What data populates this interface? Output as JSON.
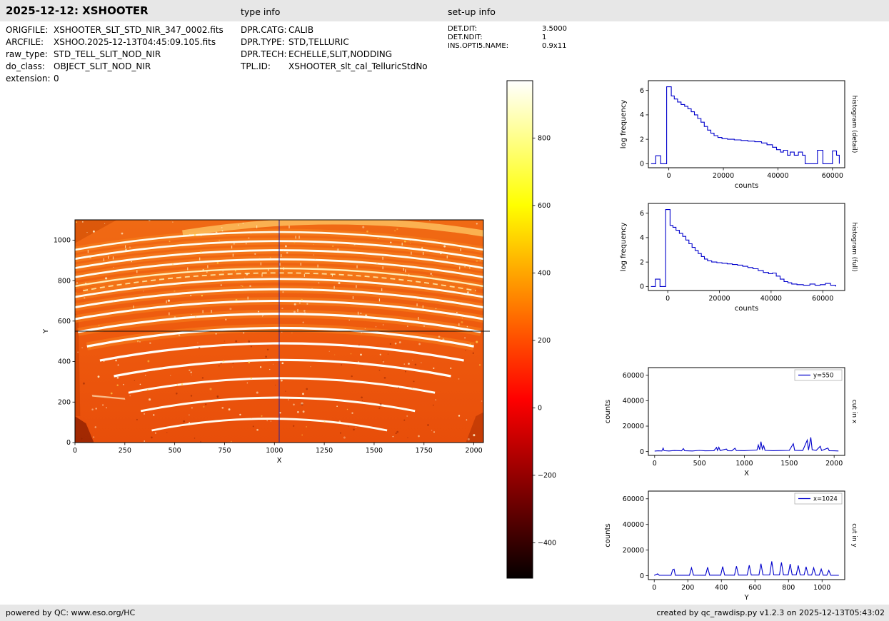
{
  "header": {
    "title": "2025-12-12: XSHOOTER",
    "type_info_title": "type info",
    "setup_info_title": "set-up info"
  },
  "file_info": {
    "rows": [
      {
        "label": "ORIGFILE:",
        "value": "XSHOOTER_SLT_STD_NIR_347_0002.fits"
      },
      {
        "label": "ARCFILE:",
        "value": "XSHOO.2025-12-13T04:45:09.105.fits"
      },
      {
        "label": "raw_type:",
        "value": "STD_TELL_SLIT_NOD_NIR"
      },
      {
        "label": "do_class:",
        "value": "OBJECT_SLIT_NOD_NIR"
      },
      {
        "label": "extension:",
        "value": "0"
      }
    ]
  },
  "type_info": {
    "rows": [
      {
        "label": "DPR.CATG:",
        "value": "CALIB"
      },
      {
        "label": "DPR.TYPE:",
        "value": "STD,TELLURIC"
      },
      {
        "label": "DPR.TECH:",
        "value": "ECHELLE,SLIT,NODDING"
      },
      {
        "label": "TPL.ID:",
        "value": "XSHOOTER_slt_cal_TelluricStdNo"
      }
    ]
  },
  "setup_info": {
    "rows": [
      {
        "label": "DET.DIT:",
        "value": "3.5000"
      },
      {
        "label": "DET.NDIT:",
        "value": "1"
      },
      {
        "label": "INS.OPTI5.NAME:",
        "value": "0.9x11"
      }
    ]
  },
  "footer": {
    "left": "powered by QC: www.eso.org/HC",
    "right": "created by qc_rawdisp.py v1.2.3 on 2025-12-13T05:43:02"
  },
  "chart_data": [
    {
      "id": "raw-image",
      "type": "heatmap",
      "description": "XSHOOTER NIR raw detector frame: bright curved echelle orders on orange background (hot colormap), crosshair cuts at x=1024 and y=550",
      "xlabel": "X",
      "ylabel": "Y",
      "xlim": [
        0,
        2048
      ],
      "ylim": [
        0,
        1100
      ],
      "xticks": [
        0,
        250,
        500,
        750,
        1000,
        1250,
        1500,
        1750,
        2000
      ],
      "yticks": [
        0,
        200,
        400,
        600,
        800,
        1000
      ],
      "colormap": "hot",
      "background_color": "#ee5a0e",
      "crosshair": {
        "x": 1024,
        "y": 550,
        "x_color": "#2020a0",
        "y_color": "#101010"
      },
      "noise_seed": 20251212,
      "noise_dots": 260,
      "dark_dots": 60,
      "skyline_count": 55,
      "orders": [
        {
          "yc": 1093,
          "sag": 60,
          "x0": 540,
          "x1": 2048,
          "w": 9,
          "color": "#ffc966",
          "opacity": 0.75
        },
        {
          "yc": 1040,
          "sag": 88,
          "x0": 0,
          "x1": 2048,
          "w": 2.6,
          "color": "#fffbea"
        },
        {
          "yc": 995,
          "sag": 88,
          "x0": 0,
          "x1": 2048,
          "w": 2.8,
          "color": "#fffdf2"
        },
        {
          "yc": 950,
          "sag": 88,
          "x0": 0,
          "x1": 2048,
          "w": 2.8,
          "color": "#fffdf2"
        },
        {
          "yc": 905,
          "sag": 88,
          "x0": 0,
          "x1": 2048,
          "w": 2.8,
          "color": "#fffcf0"
        },
        {
          "yc": 860,
          "sag": 88,
          "x0": 0,
          "x1": 2048,
          "w": 2.4,
          "color": "#ffedb8"
        },
        {
          "yc": 838,
          "sag": 88,
          "x0": 40,
          "x1": 2010,
          "w": 1.8,
          "color": "#ffe9a8",
          "dash": true,
          "opacity": 0.9
        },
        {
          "yc": 808,
          "sag": 89,
          "x0": 0,
          "x1": 2048,
          "w": 2.8,
          "color": "#fffcf0"
        },
        {
          "yc": 757,
          "sag": 89,
          "x0": 0,
          "x1": 2048,
          "w": 3,
          "color": "#fffdf4"
        },
        {
          "yc": 700,
          "sag": 90,
          "x0": 0,
          "x1": 2048,
          "w": 3,
          "color": "#fffef8"
        },
        {
          "yc": 636,
          "sag": 90,
          "x0": 15,
          "x1": 2035,
          "w": 3.2,
          "color": "#fffef8"
        },
        {
          "yc": 566,
          "sag": 91,
          "x0": 60,
          "x1": 2000,
          "w": 3.2,
          "color": "#fffefa"
        },
        {
          "yc": 490,
          "sag": 85,
          "x0": 125,
          "x1": 1950,
          "w": 3.2,
          "color": "#fffefa"
        },
        {
          "yc": 408,
          "sag": 80,
          "x0": 195,
          "x1": 1885,
          "w": 3.2,
          "color": "#fffef8"
        },
        {
          "yc": 318,
          "sag": 72,
          "x0": 268,
          "x1": 1805,
          "w": 3,
          "color": "#fffdf4"
        },
        {
          "yc": 222,
          "sag": 66,
          "x0": 330,
          "x1": 1705,
          "w": 3,
          "color": "#fffdf2"
        },
        {
          "yc": 118,
          "sag": 58,
          "x0": 385,
          "x1": 1565,
          "w": 2.8,
          "color": "#fffcf0"
        }
      ],
      "patches": [
        {
          "pts": [
            [
              0,
              0
            ],
            [
              95,
              0
            ],
            [
              55,
              95
            ],
            [
              0,
              130
            ]
          ],
          "color": "#8a1c00",
          "opacity": 0.75
        },
        {
          "pts": [
            [
              0,
              130
            ],
            [
              26,
              130
            ],
            [
              18,
              620
            ],
            [
              0,
              640
            ]
          ],
          "color": "#c03a00",
          "opacity": 0.45
        },
        {
          "pts": [
            [
              2048,
              0
            ],
            [
              1960,
              0
            ],
            [
              2010,
              130
            ],
            [
              2048,
              150
            ]
          ],
          "color": "#a62a00",
          "opacity": 0.5
        },
        {
          "pts": [
            [
              0,
              1100
            ],
            [
              210,
              1100
            ],
            [
              0,
              985
            ]
          ],
          "color": "#c44400",
          "opacity": 0.45
        },
        {
          "pts": [
            [
              85,
              235
            ],
            [
              250,
              220
            ],
            [
              252,
              212
            ],
            [
              87,
              227
            ]
          ],
          "color": "#ffe9c0",
          "opacity": 0.7
        }
      ]
    },
    {
      "id": "colorbar",
      "type": "colorbar",
      "colormap": "hot",
      "vmin": -505,
      "vmax": 970,
      "ticks": [
        800,
        600,
        400,
        200,
        0,
        -200,
        -400
      ]
    },
    {
      "id": "hist-detail",
      "type": "steps",
      "right_label": "histogram (detail)",
      "xlabel": "counts",
      "ylabel": "log frequency",
      "xlim": [
        -7500,
        64500
      ],
      "ylim": [
        -0.33,
        6.8
      ],
      "xticks": [
        0,
        20000,
        40000,
        60000
      ],
      "yticks": [
        0,
        2,
        4,
        6
      ],
      "color": "#0000cc",
      "points": [
        [
          -6500,
          0
        ],
        [
          -4800,
          0.65
        ],
        [
          -3000,
          0
        ],
        [
          -800,
          6.3
        ],
        [
          900,
          5.55
        ],
        [
          2000,
          5.3
        ],
        [
          3200,
          5.05
        ],
        [
          4500,
          4.85
        ],
        [
          5800,
          4.7
        ],
        [
          7000,
          4.5
        ],
        [
          8200,
          4.25
        ],
        [
          9400,
          4.0
        ],
        [
          10600,
          3.7
        ],
        [
          11800,
          3.4
        ],
        [
          13000,
          3.05
        ],
        [
          14200,
          2.75
        ],
        [
          15400,
          2.5
        ],
        [
          16600,
          2.3
        ],
        [
          18000,
          2.15
        ],
        [
          19500,
          2.05
        ],
        [
          21500,
          2.0
        ],
        [
          24000,
          1.95
        ],
        [
          26500,
          1.9
        ],
        [
          29000,
          1.85
        ],
        [
          31500,
          1.8
        ],
        [
          34000,
          1.7
        ],
        [
          36000,
          1.55
        ],
        [
          38000,
          1.35
        ],
        [
          39500,
          1.15
        ],
        [
          41000,
          0.95
        ],
        [
          42000,
          1.1
        ],
        [
          43500,
          0.7
        ],
        [
          44500,
          0.95
        ],
        [
          46000,
          0.7
        ],
        [
          47500,
          0.95
        ],
        [
          49000,
          0.7
        ],
        [
          50000,
          0
        ],
        [
          54500,
          1.1
        ],
        [
          56500,
          0
        ],
        [
          60000,
          1.05
        ],
        [
          61500,
          0.7
        ],
        [
          62500,
          0
        ]
      ]
    },
    {
      "id": "hist-full",
      "type": "steps",
      "right_label": "histogram (full)",
      "xlabel": "counts",
      "ylabel": "log frequency",
      "xlim": [
        -7500,
        68500
      ],
      "ylim": [
        -0.33,
        6.8
      ],
      "xticks": [
        0,
        20000,
        40000,
        60000
      ],
      "yticks": [
        0,
        2,
        4,
        6
      ],
      "color": "#0000cc",
      "points": [
        [
          -6500,
          0
        ],
        [
          -4800,
          0.6
        ],
        [
          -3000,
          0
        ],
        [
          -800,
          6.3
        ],
        [
          900,
          5.0
        ],
        [
          2000,
          4.85
        ],
        [
          3200,
          4.6
        ],
        [
          4500,
          4.35
        ],
        [
          5800,
          4.1
        ],
        [
          7000,
          3.8
        ],
        [
          8200,
          3.5
        ],
        [
          9400,
          3.2
        ],
        [
          10600,
          2.95
        ],
        [
          11800,
          2.7
        ],
        [
          13000,
          2.45
        ],
        [
          14200,
          2.25
        ],
        [
          15400,
          2.1
        ],
        [
          17000,
          2.0
        ],
        [
          19000,
          1.95
        ],
        [
          21000,
          1.9
        ],
        [
          23000,
          1.85
        ],
        [
          25000,
          1.8
        ],
        [
          27000,
          1.75
        ],
        [
          29000,
          1.65
        ],
        [
          31000,
          1.55
        ],
        [
          33000,
          1.45
        ],
        [
          35000,
          1.3
        ],
        [
          37000,
          1.15
        ],
        [
          39000,
          1.05
        ],
        [
          40500,
          1.1
        ],
        [
          42000,
          0.85
        ],
        [
          43500,
          0.6
        ],
        [
          45000,
          0.4
        ],
        [
          46500,
          0.3
        ],
        [
          48000,
          0.2
        ],
        [
          50000,
          0.15
        ],
        [
          52500,
          0.1
        ],
        [
          55000,
          0.2
        ],
        [
          57000,
          0.1
        ],
        [
          59000,
          0.15
        ],
        [
          61000,
          0.25
        ],
        [
          63000,
          0.1
        ],
        [
          65000,
          0
        ]
      ]
    },
    {
      "id": "cut-x",
      "type": "line",
      "legend": "y=550",
      "right_label": "cut in x",
      "xlabel": "X",
      "ylabel": "counts",
      "xlim": [
        -70,
        2118
      ],
      "ylim": [
        -3000,
        66000
      ],
      "xticks": [
        0,
        500,
        1000,
        1500,
        2000
      ],
      "yticks": [
        0,
        20000,
        40000,
        60000
      ],
      "color": "#0000cc",
      "points": [
        [
          0,
          400
        ],
        [
          40,
          600
        ],
        [
          80,
          500
        ],
        [
          95,
          2800
        ],
        [
          105,
          700
        ],
        [
          160,
          500
        ],
        [
          220,
          800
        ],
        [
          300,
          600
        ],
        [
          320,
          2400
        ],
        [
          335,
          700
        ],
        [
          420,
          500
        ],
        [
          500,
          900
        ],
        [
          560,
          600
        ],
        [
          660,
          700
        ],
        [
          690,
          3200
        ],
        [
          700,
          1000
        ],
        [
          715,
          3400
        ],
        [
          730,
          800
        ],
        [
          800,
          2000
        ],
        [
          815,
          700
        ],
        [
          860,
          600
        ],
        [
          895,
          2600
        ],
        [
          910,
          800
        ],
        [
          1000,
          700
        ],
        [
          1060,
          900
        ],
        [
          1140,
          1200
        ],
        [
          1155,
          5200
        ],
        [
          1170,
          1500
        ],
        [
          1185,
          7800
        ],
        [
          1200,
          1800
        ],
        [
          1215,
          4600
        ],
        [
          1230,
          900
        ],
        [
          1320,
          700
        ],
        [
          1400,
          800
        ],
        [
          1500,
          900
        ],
        [
          1545,
          6200
        ],
        [
          1560,
          1000
        ],
        [
          1650,
          800
        ],
        [
          1700,
          9000
        ],
        [
          1715,
          1200
        ],
        [
          1740,
          11200
        ],
        [
          1755,
          1500
        ],
        [
          1800,
          900
        ],
        [
          1845,
          4200
        ],
        [
          1860,
          800
        ],
        [
          1930,
          2800
        ],
        [
          1945,
          700
        ],
        [
          2000,
          600
        ],
        [
          2048,
          500
        ]
      ]
    },
    {
      "id": "cut-y",
      "type": "line",
      "legend": "x=1024",
      "right_label": "cut in y",
      "xlabel": "Y",
      "ylabel": "counts",
      "xlim": [
        -35,
        1135
      ],
      "ylim": [
        -3000,
        66000
      ],
      "xticks": [
        0,
        200,
        400,
        600,
        800,
        1000
      ],
      "yticks": [
        0,
        20000,
        40000,
        60000
      ],
      "color": "#0000cc",
      "points": [
        [
          0,
          300
        ],
        [
          20,
          1500
        ],
        [
          30,
          400
        ],
        [
          100,
          350
        ],
        [
          110,
          4800
        ],
        [
          118,
          5200
        ],
        [
          126,
          400
        ],
        [
          210,
          400
        ],
        [
          222,
          6200
        ],
        [
          234,
          450
        ],
        [
          306,
          400
        ],
        [
          318,
          6600
        ],
        [
          330,
          450
        ],
        [
          396,
          450
        ],
        [
          408,
          7200
        ],
        [
          420,
          500
        ],
        [
          478,
          450
        ],
        [
          490,
          7400
        ],
        [
          502,
          500
        ],
        [
          554,
          500
        ],
        [
          566,
          8200
        ],
        [
          578,
          550
        ],
        [
          624,
          550
        ],
        [
          636,
          9400
        ],
        [
          648,
          600
        ],
        [
          688,
          600
        ],
        [
          700,
          11200
        ],
        [
          712,
          650
        ],
        [
          746,
          650
        ],
        [
          758,
          10400
        ],
        [
          770,
          650
        ],
        [
          798,
          650
        ],
        [
          810,
          9200
        ],
        [
          822,
          650
        ],
        [
          846,
          650
        ],
        [
          858,
          8000
        ],
        [
          870,
          600
        ],
        [
          893,
          600
        ],
        [
          905,
          7000
        ],
        [
          917,
          550
        ],
        [
          938,
          550
        ],
        [
          950,
          6200
        ],
        [
          962,
          500
        ],
        [
          983,
          500
        ],
        [
          995,
          5200
        ],
        [
          1007,
          450
        ],
        [
          1028,
          450
        ],
        [
          1040,
          4200
        ],
        [
          1052,
          400
        ],
        [
          1100,
          350
        ]
      ]
    }
  ]
}
